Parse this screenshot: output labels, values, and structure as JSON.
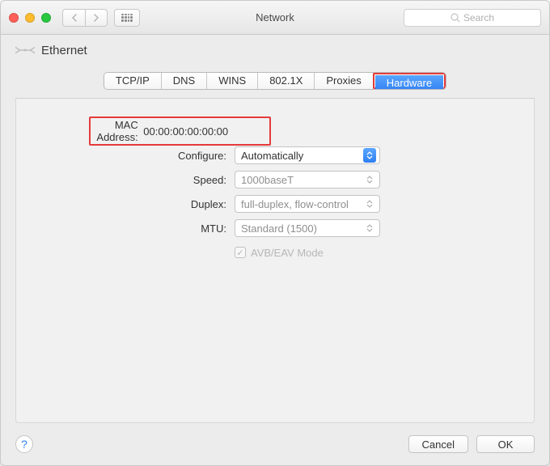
{
  "window": {
    "title": "Network"
  },
  "search": {
    "placeholder": "Search"
  },
  "header": {
    "title": "Ethernet"
  },
  "tabs": {
    "items": [
      "TCP/IP",
      "DNS",
      "WINS",
      "802.1X",
      "Proxies",
      "Hardware"
    ],
    "active_index": 5
  },
  "form": {
    "mac_label": "MAC Address:",
    "mac_value": "00:00:00:00:00:00",
    "configure_label": "Configure:",
    "configure_value": "Automatically",
    "speed_label": "Speed:",
    "speed_value": "1000baseT",
    "duplex_label": "Duplex:",
    "duplex_value": "full-duplex, flow-control",
    "mtu_label": "MTU:",
    "mtu_value": "Standard  (1500)",
    "avb_label": "AVB/EAV Mode",
    "avb_checked": true
  },
  "footer": {
    "help": "?",
    "cancel": "Cancel",
    "ok": "OK"
  }
}
